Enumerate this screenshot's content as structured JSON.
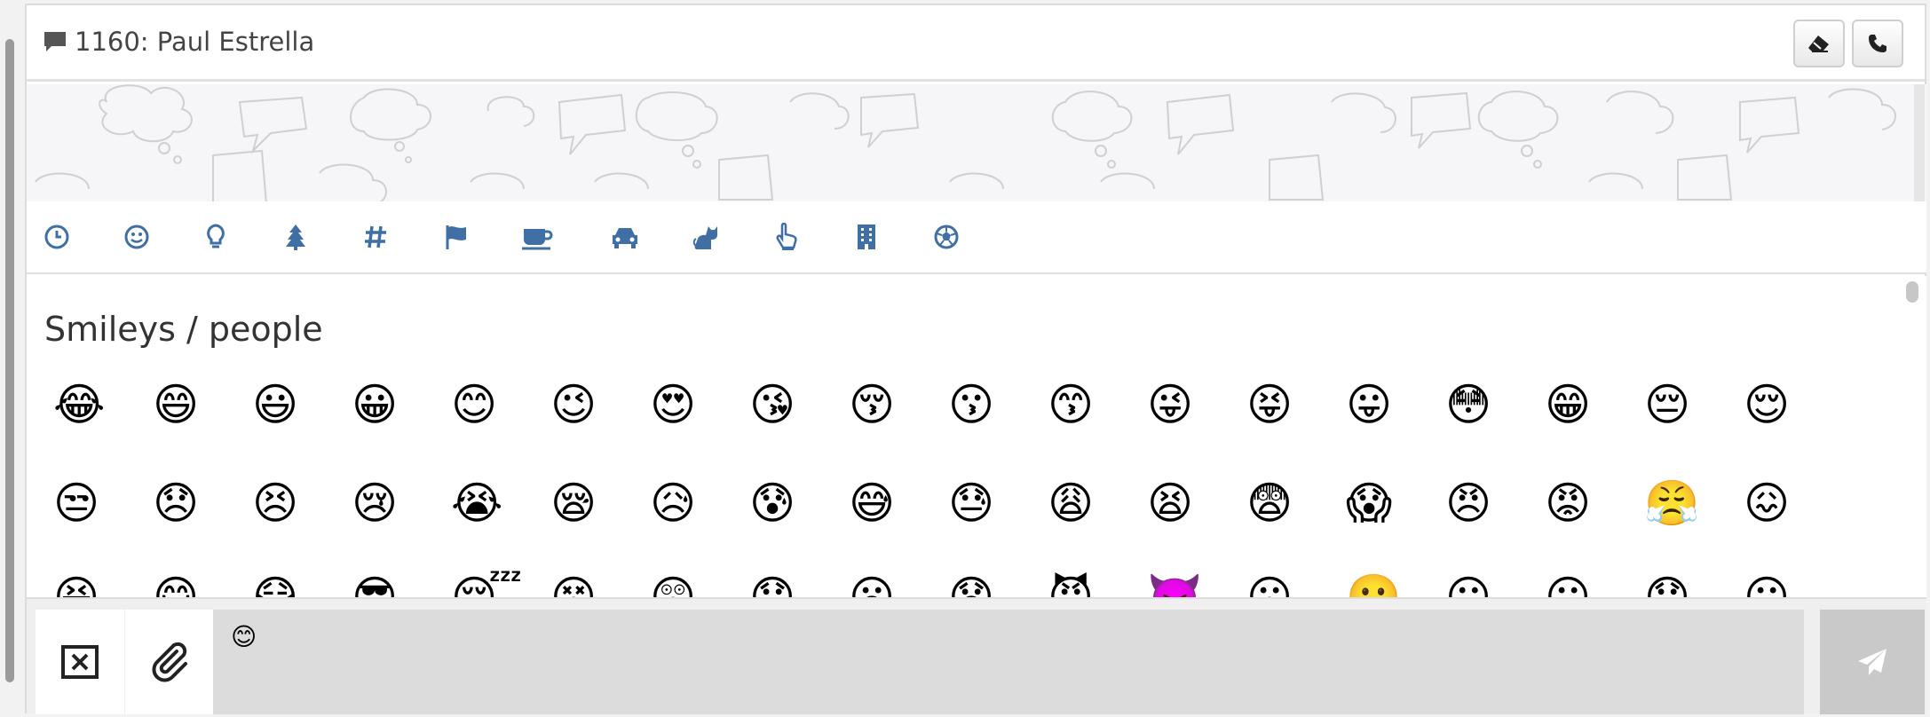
{
  "header": {
    "title": "1160: Paul Estrella"
  },
  "tabs": [
    {
      "name": "recent",
      "icon": "clock-icon"
    },
    {
      "name": "smileys",
      "icon": "smiley-icon"
    },
    {
      "name": "objects",
      "icon": "lightbulb-icon"
    },
    {
      "name": "nature",
      "icon": "tree-icon"
    },
    {
      "name": "symbols",
      "icon": "hashtag-icon"
    },
    {
      "name": "flags",
      "icon": "flag-icon"
    },
    {
      "name": "food",
      "icon": "coffee-icon"
    },
    {
      "name": "travel",
      "icon": "car-icon"
    },
    {
      "name": "animals",
      "icon": "cat-icon"
    },
    {
      "name": "gestures",
      "icon": "hand-pointer-icon"
    },
    {
      "name": "places",
      "icon": "building-icon"
    },
    {
      "name": "activity",
      "icon": "soccer-ball-icon"
    }
  ],
  "emoji_panel": {
    "section_title": "Smileys / people",
    "row1": [
      "😂",
      "😄",
      "😃",
      "😀",
      "😊",
      "😉",
      "😍",
      "😘",
      "😚",
      "😗",
      "😙",
      "😜",
      "😝",
      "😛",
      "😳",
      "😁",
      "😔",
      "😌"
    ],
    "row2": [
      "😒",
      "😞",
      "😣",
      "😢",
      "😭",
      "😪",
      "😥",
      "😰",
      "😅",
      "😓",
      "😩",
      "😫",
      "😨",
      "😱",
      "😠",
      "😡",
      "😤",
      "😖"
    ],
    "row3": [
      "😆",
      "😋",
      "😷",
      "😎",
      "😴",
      "😵",
      "😲",
      "😟",
      "😦",
      "😧",
      "😈",
      "👿",
      "😮",
      "😬",
      "😐",
      "😕",
      "😯",
      "😶"
    ]
  },
  "composer": {
    "input_value": "😊"
  },
  "colors": {
    "accent": "#3f6fa5",
    "send_bg": "#c9c9c9"
  }
}
